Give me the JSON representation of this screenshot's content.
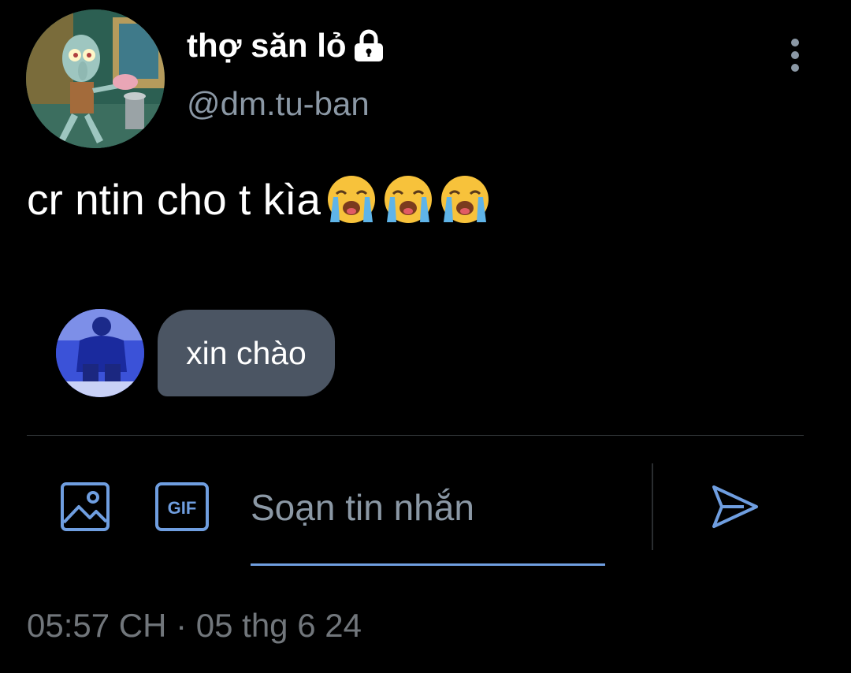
{
  "profile": {
    "display_name": "thợ săn lỏ",
    "handle": "@dm.tu-ban",
    "avatar_icon": "squidward-avatar",
    "locked_icon": "lock-icon"
  },
  "bio": {
    "text": "cr ntin cho t kìa",
    "emojis": [
      "loudly-crying-face",
      "loudly-crying-face",
      "loudly-crying-face"
    ]
  },
  "message": {
    "text": "xin chào",
    "sender_avatar_icon": "sender-avatar"
  },
  "composer": {
    "placeholder": "Soạn tin nhắn",
    "image_icon": "image-icon",
    "gif_label": "GIF",
    "send_icon": "send-icon"
  },
  "timestamp": "05:57 CH · 05 thg 6 24",
  "colors": {
    "background": "#000000",
    "accent": "#6f9ee0",
    "bubble": "#4b5563",
    "muted_text": "#8b98a5"
  }
}
